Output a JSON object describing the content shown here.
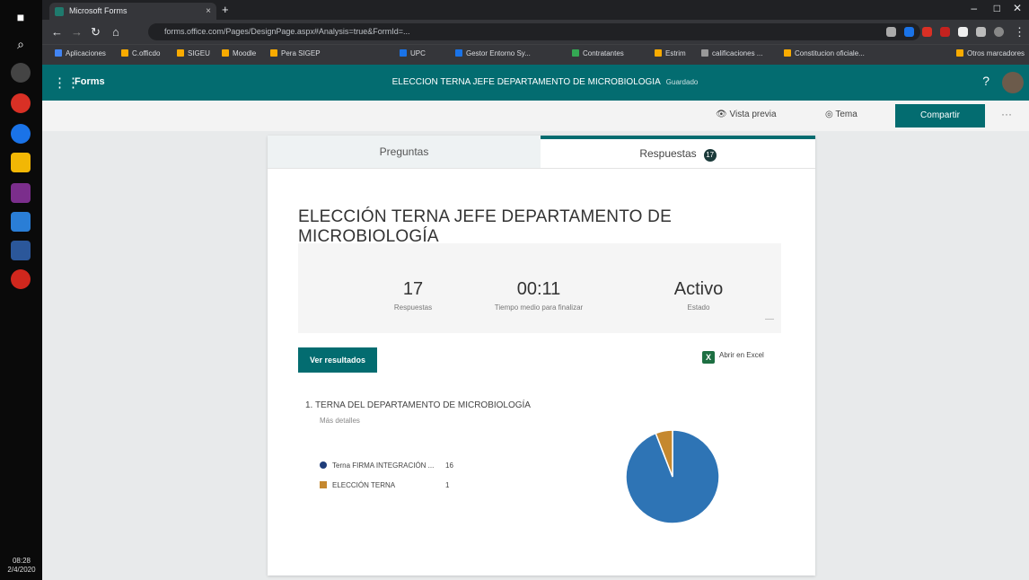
{
  "browser": {
    "tab_title": "Microsoft Forms",
    "url": "forms.office.com/Pages/DesignPage.aspx#Analysis=true&FormId=...",
    "bookmarks": [
      "Aplicaciones",
      "C.officdo",
      "SIGEU",
      "Moodle",
      "Pera SIGEP",
      "UPC",
      "Gestor Entorno Sy...",
      "Contratantes",
      "Estrim",
      "calificaciones ...",
      "Constitucion oficiale...",
      "Otros marcadores"
    ]
  },
  "app": {
    "name": "Forms",
    "form_title": "ELECCION TERNA JEFE DEPARTAMENTO DE MICROBIOLOGIA",
    "form_subtitle": "Guardado",
    "help": "?"
  },
  "commands": {
    "preview": "Vista previa",
    "theme": "Tema",
    "share": "Compartir",
    "more": "···"
  },
  "tabs": {
    "questions": "Preguntas",
    "responses": "Respuestas",
    "responses_count": "17"
  },
  "summary": {
    "title": "ELECCIÓN TERNA JEFE DEPARTAMENTO DE MICROBIOLOGÍA",
    "responses_value": "17",
    "responses_label": "Respuestas",
    "time_value": "00:11",
    "time_label": "Tiempo medio para finalizar",
    "status_value": "Activo",
    "status_label": "Estado",
    "view_results": "Ver resultados",
    "open_excel": "Abrir en Excel"
  },
  "question": {
    "title": "1.  TERNA DEL DEPARTAMENTO DE MICROBIOLOGÍA",
    "details": "Más detalles",
    "options": [
      {
        "label": "Terna FIRMA INTEGRACIÓN ...",
        "count": "16"
      },
      {
        "label": "ELECCIÓN TERNA",
        "count": "1"
      }
    ]
  },
  "chart_data": {
    "type": "pie",
    "categories": [
      "Terna FIRMA INTEGRACIÓN ...",
      "ELECCIÓN TERNA"
    ],
    "values": [
      16,
      1
    ],
    "colors": [
      "#2e74b5",
      "#c5882f"
    ]
  },
  "taskbar": {
    "time": "08:28",
    "date": "2/4/2020"
  }
}
